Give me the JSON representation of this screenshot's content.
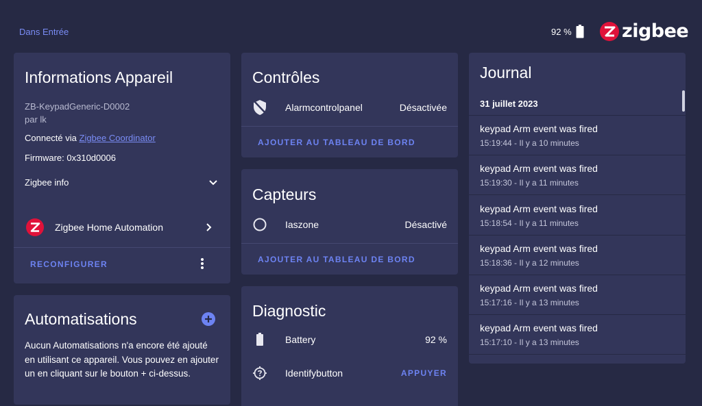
{
  "header": {
    "breadcrumb": "Dans Entrée",
    "battery_level": "92 %",
    "logo_text": "zigbee"
  },
  "device_info": {
    "title": "Informations Appareil",
    "model": "ZB-KeypadGeneric-D0002",
    "manufacturer": "par lk",
    "connected_label": "Connecté via ",
    "connected_link": "Zigbee Coordinator",
    "firmware": "Firmware: 0x310d0006",
    "zigbee_info": "Zigbee info",
    "integration": "Zigbee Home Automation",
    "reconfigure": "RECONFIGURER"
  },
  "automations": {
    "title": "Automatisations",
    "empty_text": "Aucun Automatisations n'a encore été ajouté en utilisant ce appareil. Vous pouvez en ajouter un en cliquant sur le bouton + ci-dessus."
  },
  "controls": {
    "title": "Contrôles",
    "entity_name": "Alarmcontrolpanel",
    "entity_state": "Désactivée",
    "add_button": "AJOUTER AU TABLEAU DE BORD"
  },
  "sensors": {
    "title": "Capteurs",
    "entity_name": "Iaszone",
    "entity_state": "Désactivé",
    "add_button": "AJOUTER AU TABLEAU DE BORD"
  },
  "diagnostic": {
    "title": "Diagnostic",
    "battery_name": "Battery",
    "battery_value": "92 %",
    "identify_name": "Identifybutton",
    "identify_button": "APPUYER"
  },
  "journal": {
    "title": "Journal",
    "date": "31 juillet 2023",
    "entries": [
      {
        "message": "keypad Arm event was fired",
        "time": "15:19:44 - Il y a 10 minutes"
      },
      {
        "message": "keypad Arm event was fired",
        "time": "15:19:30 - Il y a 11 minutes"
      },
      {
        "message": "keypad Arm event was fired",
        "time": "15:18:54 - Il y a 11 minutes"
      },
      {
        "message": "keypad Arm event was fired",
        "time": "15:18:36 - Il y a 12 minutes"
      },
      {
        "message": "keypad Arm event was fired",
        "time": "15:17:16 - Il y a 13 minutes"
      },
      {
        "message": "keypad Arm event was fired",
        "time": "15:17:10 - Il y a 13 minutes"
      }
    ]
  },
  "colors": {
    "background": "#262944",
    "card": "#33365a",
    "accent": "#6d83f2",
    "zigbee_red": "#e0123a"
  }
}
